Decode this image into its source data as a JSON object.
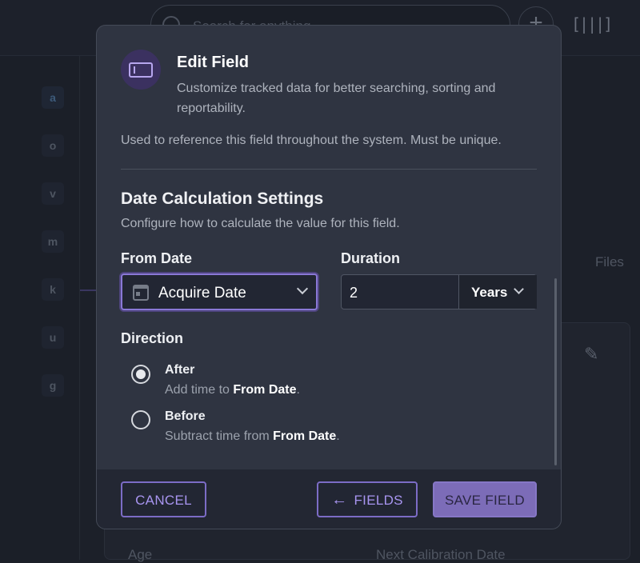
{
  "background": {
    "search_placeholder": "Search for anything",
    "sidebar_letters": [
      "a",
      "o",
      "v",
      "m",
      "k",
      "u",
      "g"
    ],
    "files_label": "Files",
    "columns": [
      "Age",
      "Next Calibration Date"
    ]
  },
  "modal": {
    "title": "Edit Field",
    "subtitle": "Customize tracked data for better searching, sorting and reportability.",
    "reference_help": "Used to reference this field throughout the system. Must be unique.",
    "section_title": "Date Calculation Settings",
    "section_desc": "Configure how to calculate the value for this field.",
    "from_date": {
      "label": "From Date",
      "value": "Acquire Date"
    },
    "duration": {
      "label": "Duration",
      "value": "2",
      "unit": "Years"
    },
    "direction": {
      "label": "Direction",
      "options": [
        {
          "label": "After",
          "desc_prefix": "Add time to ",
          "desc_bold": "From Date",
          "desc_suffix": ".",
          "selected": true
        },
        {
          "label": "Before",
          "desc_prefix": "Subtract time from ",
          "desc_bold": "From Date",
          "desc_suffix": ".",
          "selected": false
        }
      ]
    },
    "buttons": {
      "cancel": "CANCEL",
      "fields": "FIELDS",
      "save": "SAVE FIELD"
    }
  },
  "colors": {
    "accent": "#7c6cb8",
    "modal_bg": "#2f3441",
    "page_bg": "#1c2029"
  }
}
